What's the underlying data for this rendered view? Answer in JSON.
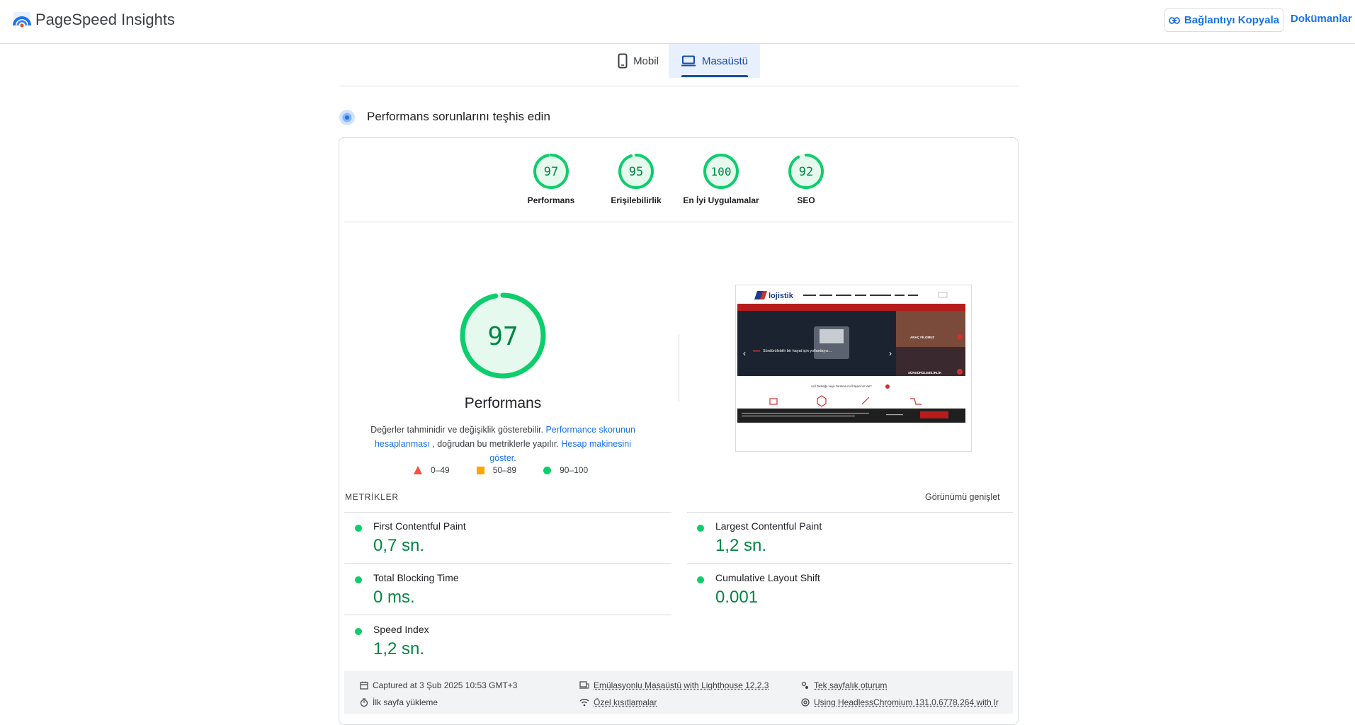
{
  "app": {
    "title": "PageSpeed Insights"
  },
  "header": {
    "copy_link_label": "Bağlantıyı Kopyala",
    "docs_label": "Dokümanlar"
  },
  "device_tabs": {
    "mobile_label": "Mobil",
    "desktop_label": "Masaüstü",
    "selected": "desktop"
  },
  "section": {
    "title": "Performans sorunlarını teşhis edin"
  },
  "categories": [
    {
      "score": "97",
      "label": "Performans"
    },
    {
      "score": "95",
      "label": "Erişilebilirlik"
    },
    {
      "score": "100",
      "label": "En İyi Uygulamalar"
    },
    {
      "score": "92",
      "label": "SEO"
    }
  ],
  "performance": {
    "score": "97",
    "title": "Performans",
    "desc_prefix": "Değerler tahminidir ve değişiklik gösterebilir.",
    "desc_link1": "Performance skorunun hesaplanması",
    "desc_mid": ", doğrudan bu metriklerle yapılır.",
    "desc_link2": "Hesap makinesini göster",
    "desc_suffix": "."
  },
  "legend": {
    "fail": "0–49",
    "average": "50–89",
    "pass": "90–100"
  },
  "colors": {
    "pass": "#0cce6b",
    "pass_text": "#018642",
    "average": "#ffa400",
    "fail": "#ff4e42",
    "link": "#1a73e8",
    "tab_active": "#174ea6"
  },
  "metrics": {
    "heading": "METRİKLER",
    "expand_label": "Görünümü genişlet",
    "items": [
      {
        "name": "First Contentful Paint",
        "value": "0,7 sn."
      },
      {
        "name": "Largest Contentful Paint",
        "value": "1,2 sn."
      },
      {
        "name": "Total Blocking Time",
        "value": "0 ms."
      },
      {
        "name": "Cumulative Layout Shift",
        "value": "0.001"
      },
      {
        "name": "Speed Index",
        "value": "1,2 sn."
      }
    ]
  },
  "screenshot": {
    "brand": "lojistik",
    "hero_text": "Sürdürülebilir bir hayat için yollardayız...",
    "tile1": "ARAÇ FİLOMUZ",
    "tile2": "SÜRDÜRÜLEBİLİRLİK",
    "support_text": "Acil Desteğe veya Yardıma mı İhtiyacınız Var?"
  },
  "footer": {
    "captured": "Captured at 3 Şub 2025 10:53 GMT+3",
    "emulation": "Emülasyonlu Masaüstü with Lighthouse 12.2.3",
    "session": "Tek sayfalık oturum",
    "load": "İlk sayfa yükleme",
    "throttling": "Özel kısıtlamalar",
    "browser": "Using HeadlessChromium 131.0.6778.264 with lr"
  }
}
